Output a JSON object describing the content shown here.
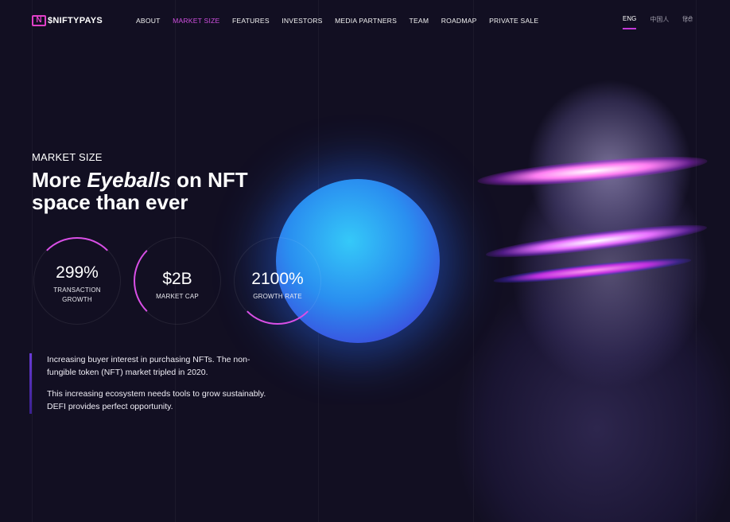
{
  "brand": {
    "logo_mark": "N",
    "name": "$NIFTYPAYS"
  },
  "nav": {
    "items": [
      {
        "label": "ABOUT",
        "active": false
      },
      {
        "label": "MARKET SIZE",
        "active": true
      },
      {
        "label": "FEATURES",
        "active": false
      },
      {
        "label": "INVESTORS",
        "active": false
      },
      {
        "label": "MEDIA PARTNERS",
        "active": false
      },
      {
        "label": "TEAM",
        "active": false
      },
      {
        "label": "ROADMAP",
        "active": false
      },
      {
        "label": "PRIVATE SALE",
        "active": false
      }
    ],
    "languages": [
      {
        "label": "ENG",
        "active": true
      },
      {
        "label": "中国人",
        "active": false
      },
      {
        "label": "हिंदी",
        "active": false
      }
    ]
  },
  "hero": {
    "eyebrow": "MARKET SIZE",
    "headline_part1": "More ",
    "headline_emphasis": "Eyeballs",
    "headline_part2": " on NFT",
    "headline_line2": "space than ever"
  },
  "stats": [
    {
      "value": "299%",
      "label_line1": "TRANSACTION",
      "label_line2": "GROWTH"
    },
    {
      "value": "$2B",
      "label_line1": "MARKET CAP",
      "label_line2": ""
    },
    {
      "value": "2100%",
      "label_line1": "GROWTH RATE",
      "label_line2": ""
    }
  ],
  "paragraphs": [
    "Increasing buyer interest in purchasing NFTs. The non-fungible token (NFT) market tripled in 2020.",
    "This increasing ecosystem needs tools to grow sustainably. DEFI provides perfect opportunity."
  ],
  "colors": {
    "background": "#120f22",
    "accent": "#d04fe0",
    "orb": "#2a8ff0"
  }
}
